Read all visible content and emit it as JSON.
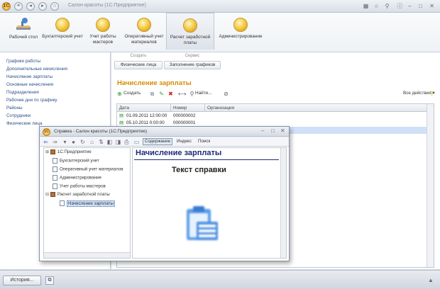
{
  "app": {
    "title": "Салон красоты  (1С:Предприятие)"
  },
  "sections": [
    {
      "label": "Рабочий стол"
    },
    {
      "label": "Бухгалтерский учет"
    },
    {
      "label": "Учет работы мастеров"
    },
    {
      "label": "Оперативный учет материалов"
    },
    {
      "label": "Расчет заработной платы"
    },
    {
      "label": "Администрирование"
    }
  ],
  "nav": [
    "Графики работы",
    "Дополнительные начисления",
    "Начисление зарплаты",
    "Основные начисления",
    "Подразделения",
    "Рабочие дни по графику",
    "Районы",
    "Сотрудники",
    "Физические лица"
  ],
  "commands": {
    "create_title": "Создать",
    "create_btn": "Физические лица",
    "service_title": "Сервис",
    "service_btn": "Заполнение графиков"
  },
  "document": {
    "title": "Начисление зарплаты",
    "create_label": "Создать",
    "find_label": "Найти...",
    "all_actions": "Все действия",
    "columns": [
      "Дата",
      "Номер",
      "Организация"
    ],
    "rows": [
      {
        "date": "01.09.2011 12:00:00",
        "number": "000000002"
      },
      {
        "date": "05.10.2011 0:00:00",
        "number": "000000001"
      }
    ]
  },
  "help": {
    "title": "Справка - Салон красоты  (1С:Предприятие)",
    "tabs": [
      "Содержание",
      "Индекс",
      "Поиск"
    ],
    "tree": [
      "1С:Предприятие",
      "Бухгалтерский учет",
      "Оперативный учет материалов",
      "Администрирование",
      "Учет работы мастеров",
      "Расчет заработной платы",
      "Начисление зарплаты"
    ],
    "heading": "Начисление зарплаты",
    "text": "Текст справки"
  },
  "statusbar": {
    "history": "История..."
  }
}
